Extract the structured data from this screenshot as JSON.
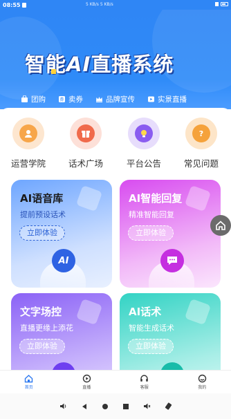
{
  "status_bar": {
    "time": "08:55",
    "speed_1": "5 KB/s",
    "speed_2": "5 KB/s"
  },
  "hero": {
    "title_pre": "智能",
    "title_ai": "AI",
    "title_post": "直播系统",
    "tags": [
      {
        "label": "团购",
        "icon": "bag-icon"
      },
      {
        "label": "卖券",
        "icon": "coupon-icon"
      },
      {
        "label": "品牌宣传",
        "icon": "crown-icon"
      },
      {
        "label": "实景直播",
        "icon": "play-icon"
      }
    ]
  },
  "menu": [
    {
      "label": "运营学院",
      "icon": "academy-icon",
      "color": "#f7a64a"
    },
    {
      "label": "话术广场",
      "icon": "gift-icon",
      "color": "#f06a4b"
    },
    {
      "label": "平台公告",
      "icon": "bulb-icon",
      "color": "#8a5cf0"
    },
    {
      "label": "常见问题",
      "icon": "question-icon",
      "color": "#f5a23b"
    }
  ],
  "cards": [
    {
      "title": "AI语音库",
      "subtitle": "提前预设话术",
      "button": "立即体验",
      "badge": "AI"
    },
    {
      "title": "AI智能回复",
      "subtitle": "精准智能回复",
      "button": "立即体验",
      "badge": "chat-icon"
    },
    {
      "title": "文字场控",
      "subtitle": "直播更缘上添花",
      "button": "立即体验",
      "badge": "text-icon"
    },
    {
      "title": "AI话术",
      "subtitle": "智能生成话术",
      "button": "立即体验",
      "badge": "script-icon"
    }
  ],
  "tabbar": [
    {
      "label": "首页",
      "icon": "home-icon",
      "active": true
    },
    {
      "label": "直播",
      "icon": "live-icon",
      "active": false
    },
    {
      "label": "客服",
      "icon": "headset-icon",
      "active": false
    },
    {
      "label": "我的",
      "icon": "profile-icon",
      "active": false
    }
  ],
  "colors": {
    "primary": "#2f86f5",
    "active_tab": "#2f7af0"
  }
}
